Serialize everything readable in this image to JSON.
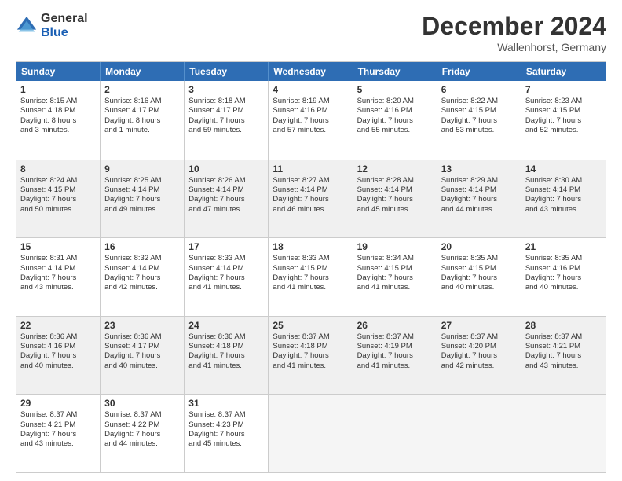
{
  "header": {
    "logo_general": "General",
    "logo_blue": "Blue",
    "month_title": "December 2024",
    "location": "Wallenhorst, Germany"
  },
  "days_of_week": [
    "Sunday",
    "Monday",
    "Tuesday",
    "Wednesday",
    "Thursday",
    "Friday",
    "Saturday"
  ],
  "rows": [
    [
      {
        "day": "1",
        "lines": [
          "Sunrise: 8:15 AM",
          "Sunset: 4:18 PM",
          "Daylight: 8 hours",
          "and 3 minutes."
        ]
      },
      {
        "day": "2",
        "lines": [
          "Sunrise: 8:16 AM",
          "Sunset: 4:17 PM",
          "Daylight: 8 hours",
          "and 1 minute."
        ]
      },
      {
        "day": "3",
        "lines": [
          "Sunrise: 8:18 AM",
          "Sunset: 4:17 PM",
          "Daylight: 7 hours",
          "and 59 minutes."
        ]
      },
      {
        "day": "4",
        "lines": [
          "Sunrise: 8:19 AM",
          "Sunset: 4:16 PM",
          "Daylight: 7 hours",
          "and 57 minutes."
        ]
      },
      {
        "day": "5",
        "lines": [
          "Sunrise: 8:20 AM",
          "Sunset: 4:16 PM",
          "Daylight: 7 hours",
          "and 55 minutes."
        ]
      },
      {
        "day": "6",
        "lines": [
          "Sunrise: 8:22 AM",
          "Sunset: 4:15 PM",
          "Daylight: 7 hours",
          "and 53 minutes."
        ]
      },
      {
        "day": "7",
        "lines": [
          "Sunrise: 8:23 AM",
          "Sunset: 4:15 PM",
          "Daylight: 7 hours",
          "and 52 minutes."
        ]
      }
    ],
    [
      {
        "day": "8",
        "lines": [
          "Sunrise: 8:24 AM",
          "Sunset: 4:15 PM",
          "Daylight: 7 hours",
          "and 50 minutes."
        ]
      },
      {
        "day": "9",
        "lines": [
          "Sunrise: 8:25 AM",
          "Sunset: 4:14 PM",
          "Daylight: 7 hours",
          "and 49 minutes."
        ]
      },
      {
        "day": "10",
        "lines": [
          "Sunrise: 8:26 AM",
          "Sunset: 4:14 PM",
          "Daylight: 7 hours",
          "and 47 minutes."
        ]
      },
      {
        "day": "11",
        "lines": [
          "Sunrise: 8:27 AM",
          "Sunset: 4:14 PM",
          "Daylight: 7 hours",
          "and 46 minutes."
        ]
      },
      {
        "day": "12",
        "lines": [
          "Sunrise: 8:28 AM",
          "Sunset: 4:14 PM",
          "Daylight: 7 hours",
          "and 45 minutes."
        ]
      },
      {
        "day": "13",
        "lines": [
          "Sunrise: 8:29 AM",
          "Sunset: 4:14 PM",
          "Daylight: 7 hours",
          "and 44 minutes."
        ]
      },
      {
        "day": "14",
        "lines": [
          "Sunrise: 8:30 AM",
          "Sunset: 4:14 PM",
          "Daylight: 7 hours",
          "and 43 minutes."
        ]
      }
    ],
    [
      {
        "day": "15",
        "lines": [
          "Sunrise: 8:31 AM",
          "Sunset: 4:14 PM",
          "Daylight: 7 hours",
          "and 43 minutes."
        ]
      },
      {
        "day": "16",
        "lines": [
          "Sunrise: 8:32 AM",
          "Sunset: 4:14 PM",
          "Daylight: 7 hours",
          "and 42 minutes."
        ]
      },
      {
        "day": "17",
        "lines": [
          "Sunrise: 8:33 AM",
          "Sunset: 4:14 PM",
          "Daylight: 7 hours",
          "and 41 minutes."
        ]
      },
      {
        "day": "18",
        "lines": [
          "Sunrise: 8:33 AM",
          "Sunset: 4:15 PM",
          "Daylight: 7 hours",
          "and 41 minutes."
        ]
      },
      {
        "day": "19",
        "lines": [
          "Sunrise: 8:34 AM",
          "Sunset: 4:15 PM",
          "Daylight: 7 hours",
          "and 41 minutes."
        ]
      },
      {
        "day": "20",
        "lines": [
          "Sunrise: 8:35 AM",
          "Sunset: 4:15 PM",
          "Daylight: 7 hours",
          "and 40 minutes."
        ]
      },
      {
        "day": "21",
        "lines": [
          "Sunrise: 8:35 AM",
          "Sunset: 4:16 PM",
          "Daylight: 7 hours",
          "and 40 minutes."
        ]
      }
    ],
    [
      {
        "day": "22",
        "lines": [
          "Sunrise: 8:36 AM",
          "Sunset: 4:16 PM",
          "Daylight: 7 hours",
          "and 40 minutes."
        ]
      },
      {
        "day": "23",
        "lines": [
          "Sunrise: 8:36 AM",
          "Sunset: 4:17 PM",
          "Daylight: 7 hours",
          "and 40 minutes."
        ]
      },
      {
        "day": "24",
        "lines": [
          "Sunrise: 8:36 AM",
          "Sunset: 4:18 PM",
          "Daylight: 7 hours",
          "and 41 minutes."
        ]
      },
      {
        "day": "25",
        "lines": [
          "Sunrise: 8:37 AM",
          "Sunset: 4:18 PM",
          "Daylight: 7 hours",
          "and 41 minutes."
        ]
      },
      {
        "day": "26",
        "lines": [
          "Sunrise: 8:37 AM",
          "Sunset: 4:19 PM",
          "Daylight: 7 hours",
          "and 41 minutes."
        ]
      },
      {
        "day": "27",
        "lines": [
          "Sunrise: 8:37 AM",
          "Sunset: 4:20 PM",
          "Daylight: 7 hours",
          "and 42 minutes."
        ]
      },
      {
        "day": "28",
        "lines": [
          "Sunrise: 8:37 AM",
          "Sunset: 4:21 PM",
          "Daylight: 7 hours",
          "and 43 minutes."
        ]
      }
    ],
    [
      {
        "day": "29",
        "lines": [
          "Sunrise: 8:37 AM",
          "Sunset: 4:21 PM",
          "Daylight: 7 hours",
          "and 43 minutes."
        ]
      },
      {
        "day": "30",
        "lines": [
          "Sunrise: 8:37 AM",
          "Sunset: 4:22 PM",
          "Daylight: 7 hours",
          "and 44 minutes."
        ]
      },
      {
        "day": "31",
        "lines": [
          "Sunrise: 8:37 AM",
          "Sunset: 4:23 PM",
          "Daylight: 7 hours",
          "and 45 minutes."
        ]
      },
      {
        "day": "",
        "lines": []
      },
      {
        "day": "",
        "lines": []
      },
      {
        "day": "",
        "lines": []
      },
      {
        "day": "",
        "lines": []
      }
    ]
  ]
}
